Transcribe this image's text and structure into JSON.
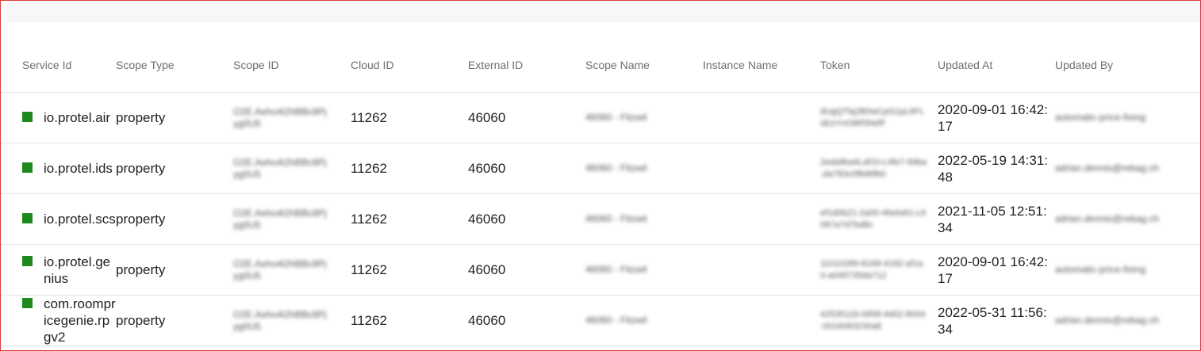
{
  "table": {
    "columns": [
      "Service Id",
      "Scope Type",
      "Scope ID",
      "Cloud ID",
      "External ID",
      "Scope Name",
      "Instance Name",
      "Token",
      "Updated At",
      "Updated By"
    ],
    "status_color": "#1e8a1e",
    "rows": [
      {
        "service_id": "io.protel.air",
        "scope_type": "property",
        "scope_id": "O2E.Aeho4i2hBBc8Pjyg0U5",
        "cloud_id": "11262",
        "external_id": "46060",
        "scope_name": "46060 - Fitzwil",
        "instance_name": "",
        "token": "dUgQTlq2B0wCpG1pL6FLsEoYnO8R5hkfF",
        "updated_at": "2020-09-01 16:42:17",
        "updated_by": "automatic-price-fixing"
      },
      {
        "service_id": "io.protel.ids",
        "scope_type": "property",
        "scope_id": "O2E.Aeho4i2hBBc8Pjyg0U5",
        "cloud_id": "11262",
        "external_id": "46060",
        "scope_name": "46060 - Fitzwil",
        "instance_name": "",
        "token": "2esb8ka4LdO3-L4fe7-99ba-da783c0f8d6fb0",
        "updated_at": "2022-05-19 14:31:48",
        "updated_by": "adrian.dennis@rebag.ch"
      },
      {
        "service_id": "io.protel.scs",
        "scope_type": "property",
        "scope_id": "O2E.Aeho4i2hBBc8Pjyg0U5",
        "cloud_id": "11262",
        "external_id": "46060",
        "scope_name": "46060 - Fitzwil",
        "instance_name": "",
        "token": "ef1d0b21-2a00-4fa4a91-L6087a7d7bd8c",
        "updated_at": "2021-11-05 12:51:34",
        "updated_by": "adrian.dennis@rebag.ch"
      },
      {
        "service_id": "io.protel.genius",
        "scope_type": "property",
        "scope_id": "O2E.Aeho4i2hBBc8Pjyg0U5",
        "cloud_id": "11262",
        "external_id": "46060",
        "scope_name": "46060 - Fitzwil",
        "instance_name": "",
        "token": "11010289-8168-4182-af1a0-a049735da712",
        "updated_at": "2020-09-01 16:42:17",
        "updated_by": "automatic-price-fixing"
      },
      {
        "service_id": "com.roompricegenie.rpgv2",
        "scope_type": "property",
        "scope_id": "O2E.Aeho4i2hBBc8Pjyg0U5",
        "cloud_id": "11262",
        "external_id": "46060",
        "scope_name": "46060 - Fitzwil",
        "instance_name": "",
        "token": "42535118-0858-4d02-8004-0016083230a8",
        "updated_at": "2022-05-31 11:56:34",
        "updated_by": "adrian.dennis@rebag.ch"
      }
    ]
  }
}
